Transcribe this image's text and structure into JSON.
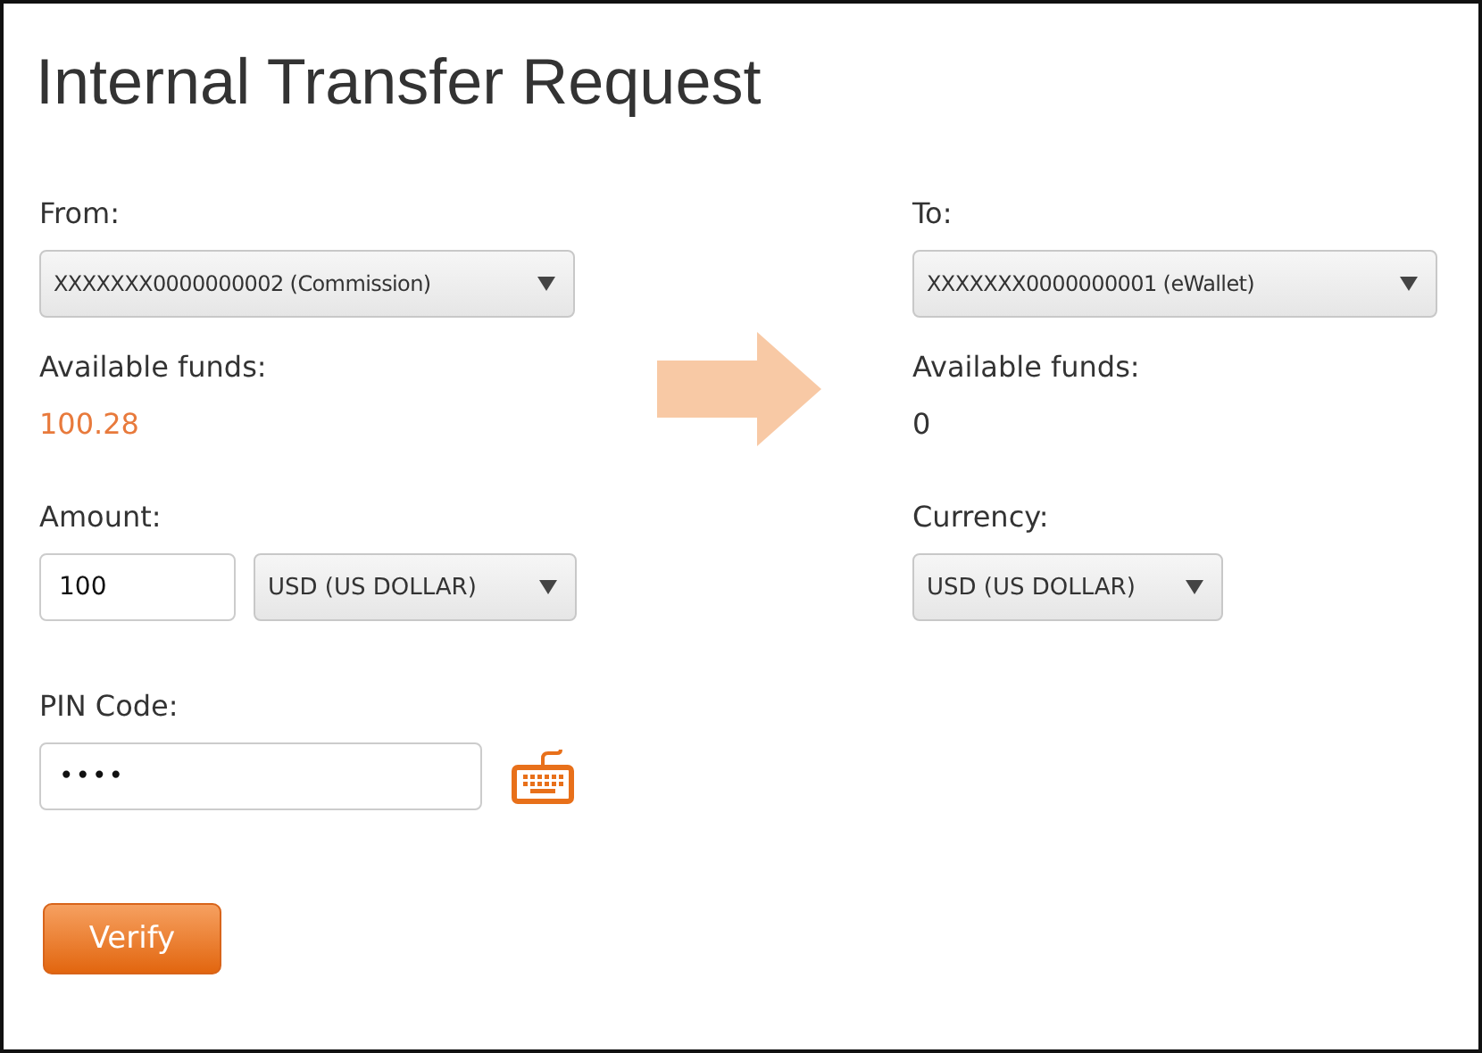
{
  "title": "Internal Transfer Request",
  "from": {
    "label": "From:",
    "account": "XXXXXXX0000000002 (Commission)",
    "funds_label": "Available funds:",
    "funds": "100.28",
    "amount_label": "Amount:",
    "amount": "100",
    "currency": "USD (US DOLLAR)",
    "pin_label": "PIN Code:",
    "pin": "••••"
  },
  "to": {
    "label": "To:",
    "account": "XXXXXXX0000000001  (eWallet)",
    "funds_label": "Available funds:",
    "funds": "0",
    "currency_label": "Currency:",
    "currency": "USD (US DOLLAR)"
  },
  "verify_button": "Verify"
}
